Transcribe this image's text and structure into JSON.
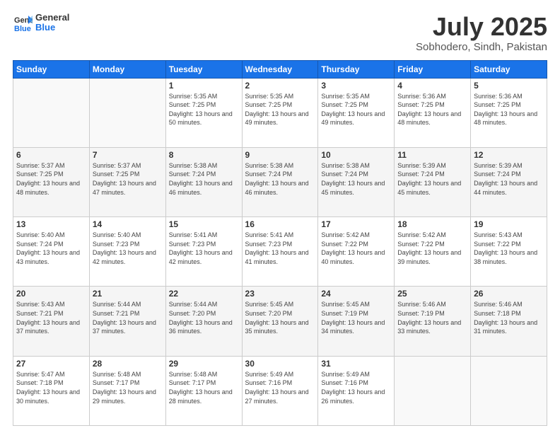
{
  "header": {
    "logo_general": "General",
    "logo_blue": "Blue",
    "title": "July 2025",
    "subtitle": "Sobhodero, Sindh, Pakistan"
  },
  "days_of_week": [
    "Sunday",
    "Monday",
    "Tuesday",
    "Wednesday",
    "Thursday",
    "Friday",
    "Saturday"
  ],
  "weeks": [
    [
      {
        "day": "",
        "info": ""
      },
      {
        "day": "",
        "info": ""
      },
      {
        "day": "1",
        "info": "Sunrise: 5:35 AM\nSunset: 7:25 PM\nDaylight: 13 hours and 50 minutes."
      },
      {
        "day": "2",
        "info": "Sunrise: 5:35 AM\nSunset: 7:25 PM\nDaylight: 13 hours and 49 minutes."
      },
      {
        "day": "3",
        "info": "Sunrise: 5:35 AM\nSunset: 7:25 PM\nDaylight: 13 hours and 49 minutes."
      },
      {
        "day": "4",
        "info": "Sunrise: 5:36 AM\nSunset: 7:25 PM\nDaylight: 13 hours and 48 minutes."
      },
      {
        "day": "5",
        "info": "Sunrise: 5:36 AM\nSunset: 7:25 PM\nDaylight: 13 hours and 48 minutes."
      }
    ],
    [
      {
        "day": "6",
        "info": "Sunrise: 5:37 AM\nSunset: 7:25 PM\nDaylight: 13 hours and 48 minutes."
      },
      {
        "day": "7",
        "info": "Sunrise: 5:37 AM\nSunset: 7:25 PM\nDaylight: 13 hours and 47 minutes."
      },
      {
        "day": "8",
        "info": "Sunrise: 5:38 AM\nSunset: 7:24 PM\nDaylight: 13 hours and 46 minutes."
      },
      {
        "day": "9",
        "info": "Sunrise: 5:38 AM\nSunset: 7:24 PM\nDaylight: 13 hours and 46 minutes."
      },
      {
        "day": "10",
        "info": "Sunrise: 5:38 AM\nSunset: 7:24 PM\nDaylight: 13 hours and 45 minutes."
      },
      {
        "day": "11",
        "info": "Sunrise: 5:39 AM\nSunset: 7:24 PM\nDaylight: 13 hours and 45 minutes."
      },
      {
        "day": "12",
        "info": "Sunrise: 5:39 AM\nSunset: 7:24 PM\nDaylight: 13 hours and 44 minutes."
      }
    ],
    [
      {
        "day": "13",
        "info": "Sunrise: 5:40 AM\nSunset: 7:24 PM\nDaylight: 13 hours and 43 minutes."
      },
      {
        "day": "14",
        "info": "Sunrise: 5:40 AM\nSunset: 7:23 PM\nDaylight: 13 hours and 42 minutes."
      },
      {
        "day": "15",
        "info": "Sunrise: 5:41 AM\nSunset: 7:23 PM\nDaylight: 13 hours and 42 minutes."
      },
      {
        "day": "16",
        "info": "Sunrise: 5:41 AM\nSunset: 7:23 PM\nDaylight: 13 hours and 41 minutes."
      },
      {
        "day": "17",
        "info": "Sunrise: 5:42 AM\nSunset: 7:22 PM\nDaylight: 13 hours and 40 minutes."
      },
      {
        "day": "18",
        "info": "Sunrise: 5:42 AM\nSunset: 7:22 PM\nDaylight: 13 hours and 39 minutes."
      },
      {
        "day": "19",
        "info": "Sunrise: 5:43 AM\nSunset: 7:22 PM\nDaylight: 13 hours and 38 minutes."
      }
    ],
    [
      {
        "day": "20",
        "info": "Sunrise: 5:43 AM\nSunset: 7:21 PM\nDaylight: 13 hours and 37 minutes."
      },
      {
        "day": "21",
        "info": "Sunrise: 5:44 AM\nSunset: 7:21 PM\nDaylight: 13 hours and 37 minutes."
      },
      {
        "day": "22",
        "info": "Sunrise: 5:44 AM\nSunset: 7:20 PM\nDaylight: 13 hours and 36 minutes."
      },
      {
        "day": "23",
        "info": "Sunrise: 5:45 AM\nSunset: 7:20 PM\nDaylight: 13 hours and 35 minutes."
      },
      {
        "day": "24",
        "info": "Sunrise: 5:45 AM\nSunset: 7:19 PM\nDaylight: 13 hours and 34 minutes."
      },
      {
        "day": "25",
        "info": "Sunrise: 5:46 AM\nSunset: 7:19 PM\nDaylight: 13 hours and 33 minutes."
      },
      {
        "day": "26",
        "info": "Sunrise: 5:46 AM\nSunset: 7:18 PM\nDaylight: 13 hours and 31 minutes."
      }
    ],
    [
      {
        "day": "27",
        "info": "Sunrise: 5:47 AM\nSunset: 7:18 PM\nDaylight: 13 hours and 30 minutes."
      },
      {
        "day": "28",
        "info": "Sunrise: 5:48 AM\nSunset: 7:17 PM\nDaylight: 13 hours and 29 minutes."
      },
      {
        "day": "29",
        "info": "Sunrise: 5:48 AM\nSunset: 7:17 PM\nDaylight: 13 hours and 28 minutes."
      },
      {
        "day": "30",
        "info": "Sunrise: 5:49 AM\nSunset: 7:16 PM\nDaylight: 13 hours and 27 minutes."
      },
      {
        "day": "31",
        "info": "Sunrise: 5:49 AM\nSunset: 7:16 PM\nDaylight: 13 hours and 26 minutes."
      },
      {
        "day": "",
        "info": ""
      },
      {
        "day": "",
        "info": ""
      }
    ]
  ]
}
